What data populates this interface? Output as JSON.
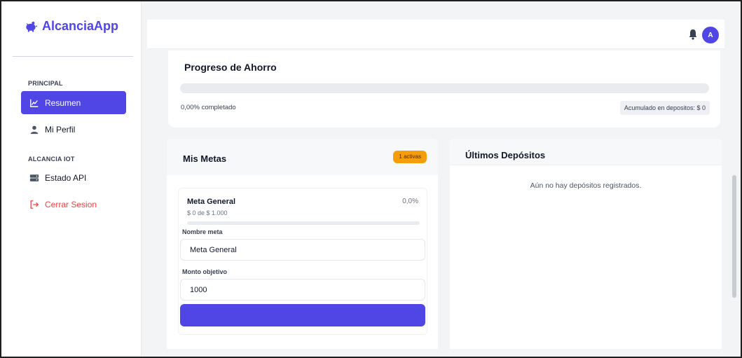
{
  "app": {
    "name": "AlcanciaApp",
    "brand_color": "#4f46e5"
  },
  "sidebar": {
    "sections": [
      {
        "label": "PRINCIPAL"
      },
      {
        "label": "ALCANCIA IOT"
      }
    ],
    "items": [
      {
        "label": "Resumen",
        "icon": "chart-line-icon",
        "active": true
      },
      {
        "label": "Mi Perfil",
        "icon": "user-icon"
      },
      {
        "label": "Estado API",
        "icon": "server-icon"
      },
      {
        "label": "Cerrar Sesion",
        "icon": "logout-icon",
        "color": "#ef4444"
      }
    ]
  },
  "topbar": {
    "avatar_initial": "A",
    "bell_icon": "bell-icon"
  },
  "progress": {
    "title": "Progreso de Ahorro",
    "percent_label": "0,00% completado",
    "percent_value": 0,
    "accumulated_label": "Acumulado en depositos: $ 0"
  },
  "metas": {
    "title": "Mis Metas",
    "badge": "1 activas",
    "badge_color": "#f59e0b",
    "card": {
      "name": "Meta General",
      "percent": "0,0%",
      "percent_value": 0,
      "amount": "$ 0 de $ 1.000",
      "name_label": "Nombre meta",
      "name_value": "Meta General",
      "target_label": "Monto objetivo",
      "target_value": "1000",
      "button_label": ""
    }
  },
  "deposits": {
    "title": "Últimos Depósitos",
    "empty_text": "Aún no hay depósitos registrados."
  }
}
